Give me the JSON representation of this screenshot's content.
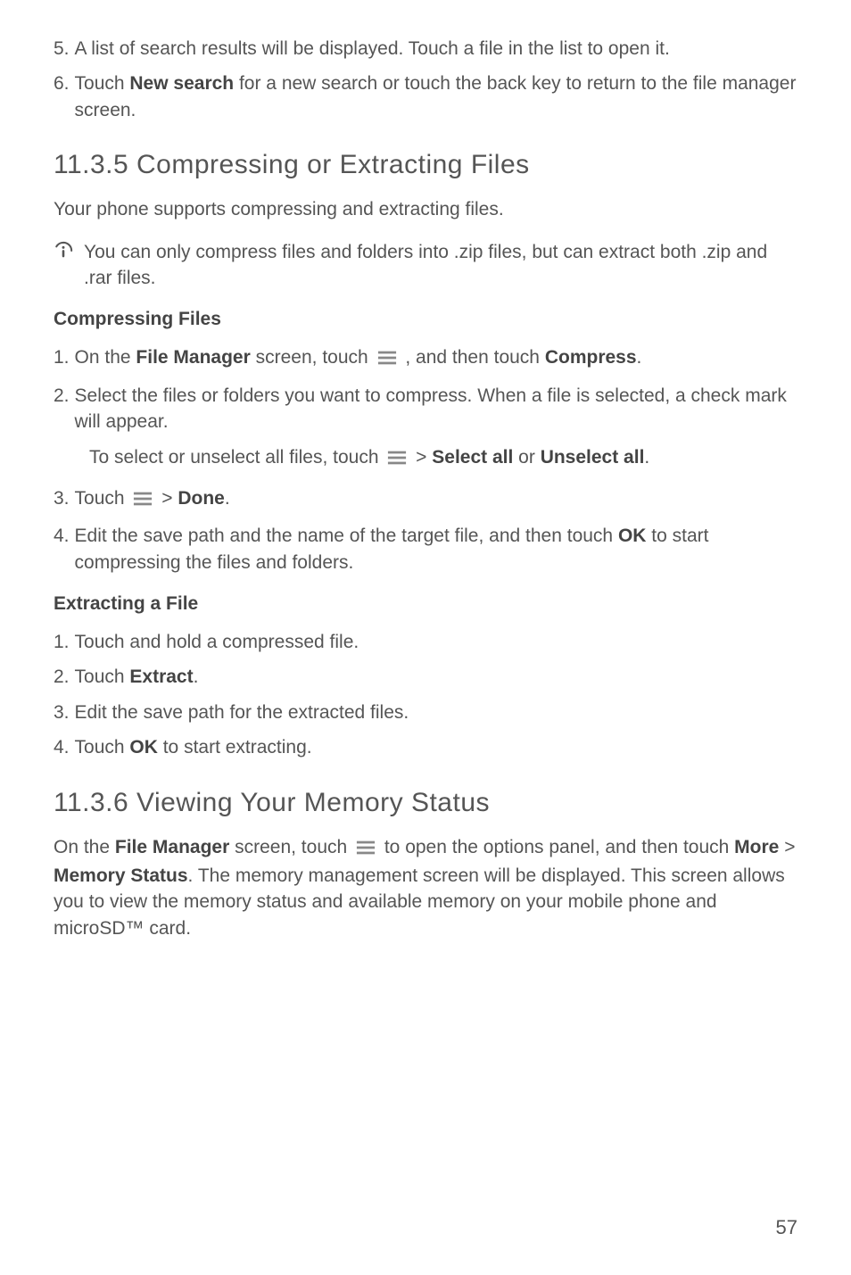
{
  "steps_top": {
    "s5_num": "5.",
    "s5_a": "A list of search results will be displayed. Touch a file in the list to open it.",
    "s6_num": "6.",
    "s6_a": "Touch ",
    "s6_b": "New search",
    "s6_c": " for a new search or touch the back key to return to the file manager screen."
  },
  "sec_11_3_5": {
    "heading": "11.3.5   Compressing  or  Extracting  Files",
    "intro": "Your phone supports compressing and extracting files.",
    "note": "You can only compress files and folders into .zip files, but can extract both .zip and .rar files."
  },
  "compressing": {
    "heading": "Compressing Files",
    "s1_num": "1.",
    "s1_a": "On the ",
    "s1_b": "File Manager",
    "s1_c": " screen, touch ",
    "s1_d": " , and then touch ",
    "s1_e": "Compress",
    "s1_f": ".",
    "s2_num": "2.",
    "s2_a": "Select the files or folders you want to compress. When a file is selected, a check mark will appear.",
    "nested_a": "To select or unselect all files, touch ",
    "nested_b": "  > ",
    "nested_c": "Select all",
    "nested_d": " or ",
    "nested_e": "Unselect all",
    "nested_f": ".",
    "s3_num": "3.",
    "s3_a": "Touch ",
    "s3_b": "  > ",
    "s3_c": "Done",
    "s3_d": ".",
    "s4_num": "4.",
    "s4_a": "Edit the save path and the name of the target file, and then touch ",
    "s4_b": "OK",
    "s4_c": " to start compressing the files and folders."
  },
  "extracting": {
    "heading": "Extracting a File",
    "s1_num": "1.",
    "s1_a": "Touch and hold a compressed file.",
    "s2_num": "2.",
    "s2_a": "Touch ",
    "s2_b": "Extract",
    "s2_c": ".",
    "s3_num": "3.",
    "s3_a": "Edit the save path for the extracted files.",
    "s4_num": "4.",
    "s4_a": "Touch ",
    "s4_b": "OK",
    "s4_c": " to start extracting."
  },
  "sec_11_3_6": {
    "heading": "11.3.6   Viewing  Your  Memory  Status",
    "p_a": "On the ",
    "p_b": "File Manager",
    "p_c": " screen, touch ",
    "p_d": "  to open the options panel, and then touch ",
    "p_e": "More",
    "p_f": " > ",
    "p_g": "Memory Status",
    "p_h": ". The memory management screen will be displayed. This screen allows you to view the memory status and available memory on your mobile phone and microSD™ card."
  },
  "page_number": "57"
}
